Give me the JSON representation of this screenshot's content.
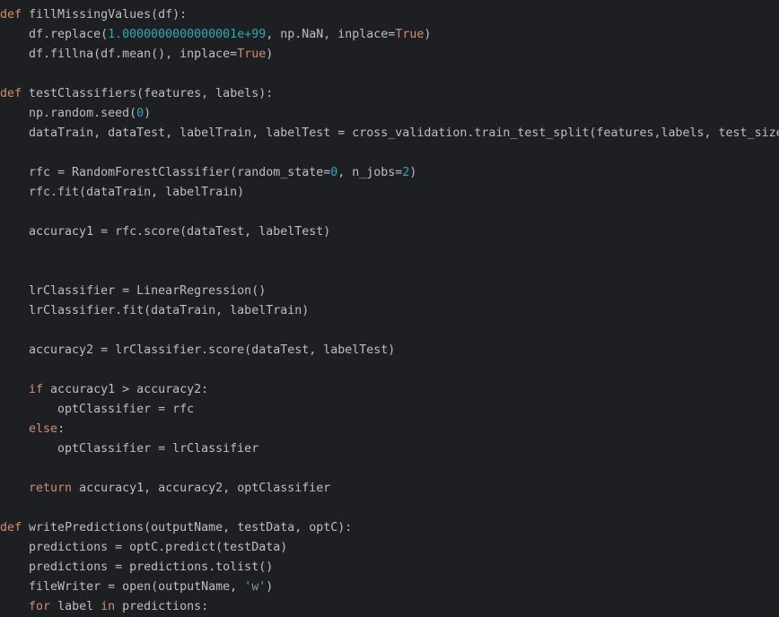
{
  "colors": {
    "background": "#1e1f22",
    "text": "#bcbec4",
    "keyword": "#cf8e6d",
    "number": "#2aacb8",
    "string": "#6aab73"
  },
  "code_lines": [
    [
      [
        "k",
        "def"
      ],
      [
        "p",
        " fillMissingValues(df):"
      ]
    ],
    [
      [
        "p",
        "    df.replace("
      ],
      [
        "n",
        "1.0000000000000001e+99"
      ],
      [
        "p",
        ", np.NaN, inplace="
      ],
      [
        "k",
        "True"
      ],
      [
        "p",
        ")"
      ]
    ],
    [
      [
        "p",
        "    df.fillna(df.mean(), inplace="
      ],
      [
        "k",
        "True"
      ],
      [
        "p",
        ")"
      ]
    ],
    [],
    [
      [
        "k",
        "def"
      ],
      [
        "p",
        " testClassifiers(features, labels):"
      ]
    ],
    [
      [
        "p",
        "    np.random.seed("
      ],
      [
        "n",
        "0"
      ],
      [
        "p",
        ")"
      ]
    ],
    [
      [
        "p",
        "    dataTrain, dataTest, labelTrain, labelTest = cross_validation.train_test_split(features,labels, test_size"
      ]
    ],
    [],
    [
      [
        "p",
        "    rfc = RandomForestClassifier(random_state="
      ],
      [
        "n",
        "0"
      ],
      [
        "p",
        ", n_jobs="
      ],
      [
        "n",
        "2"
      ],
      [
        "p",
        ")"
      ]
    ],
    [
      [
        "p",
        "    rfc.fit(dataTrain, labelTrain)"
      ]
    ],
    [],
    [
      [
        "p",
        "    accuracy1 = rfc.score(dataTest, labelTest)"
      ]
    ],
    [],
    [],
    [
      [
        "p",
        "    lrClassifier = LinearRegression()"
      ]
    ],
    [
      [
        "p",
        "    lrClassifier.fit(dataTrain, labelTrain)"
      ]
    ],
    [],
    [
      [
        "p",
        "    accuracy2 = lrClassifier.score(dataTest, labelTest)"
      ]
    ],
    [],
    [
      [
        "p",
        "    "
      ],
      [
        "k",
        "if"
      ],
      [
        "p",
        " accuracy1 > accuracy2:"
      ]
    ],
    [
      [
        "p",
        "        optClassifier = rfc"
      ]
    ],
    [
      [
        "p",
        "    "
      ],
      [
        "k",
        "else"
      ],
      [
        "p",
        ":"
      ]
    ],
    [
      [
        "p",
        "        optClassifier = lrClassifier"
      ]
    ],
    [],
    [
      [
        "p",
        "    "
      ],
      [
        "k",
        "return"
      ],
      [
        "p",
        " accuracy1, accuracy2, optClassifier"
      ]
    ],
    [],
    [
      [
        "k",
        "def"
      ],
      [
        "p",
        " writePredictions(outputName, testData, optC):"
      ]
    ],
    [
      [
        "p",
        "    predictions = optC.predict(testData)"
      ]
    ],
    [
      [
        "p",
        "    predictions = predictions.tolist()"
      ]
    ],
    [
      [
        "p",
        "    fileWriter = open(outputName, "
      ],
      [
        "s",
        "'w'"
      ],
      [
        "p",
        ")"
      ]
    ],
    [
      [
        "p",
        "    "
      ],
      [
        "k",
        "for"
      ],
      [
        "p",
        " label "
      ],
      [
        "k",
        "in"
      ],
      [
        "p",
        " predictions:"
      ]
    ]
  ]
}
